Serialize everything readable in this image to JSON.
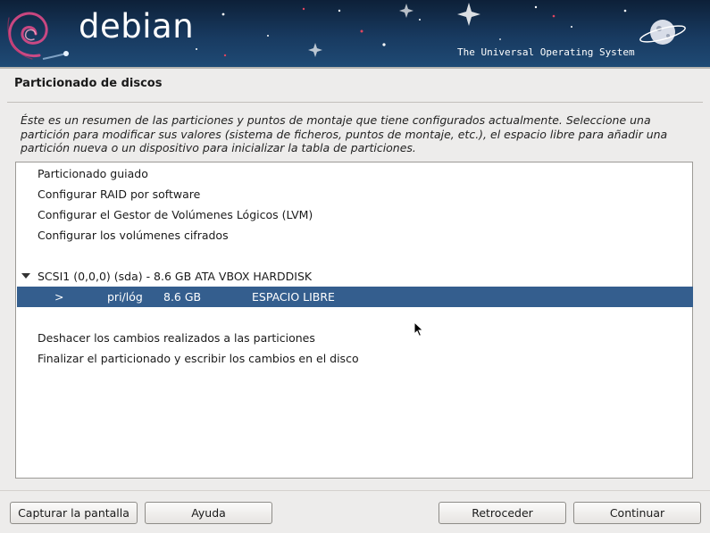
{
  "banner": {
    "brand": "debian",
    "tagline": "The Universal Operating System"
  },
  "page": {
    "title": "Particionado de discos",
    "description": "Éste es un resumen de las particiones y puntos de montaje que tiene configurados actualmente. Seleccione una partición para modificar sus valores (sistema de ficheros, puntos de montaje, etc.), el espacio libre para añadir una partición nueva o un dispositivo para inicializar la tabla de particiones."
  },
  "list": {
    "guided": "Particionado guiado",
    "raid": "Configurar RAID por software",
    "lvm": "Configurar el Gestor de Volúmenes Lógicos (LVM)",
    "crypto": "Configurar los volúmenes cifrados",
    "disk": "SCSI1 (0,0,0) (sda) - 8.6 GB ATA VBOX HARDDISK",
    "free_space": {
      "marker": ">",
      "type": "pri/lóg",
      "size": "8.6 GB",
      "label": "ESPACIO LIBRE"
    },
    "undo": "Deshacer los cambios realizados a las particiones",
    "finish": "Finalizar el particionado y escribir los cambios en el disco"
  },
  "buttons": {
    "screenshot": "Capturar la pantalla",
    "help": "Ayuda",
    "back": "Retroceder",
    "continue": "Continuar"
  },
  "colors": {
    "selection": "#345e8e",
    "banner": "#183a60"
  }
}
